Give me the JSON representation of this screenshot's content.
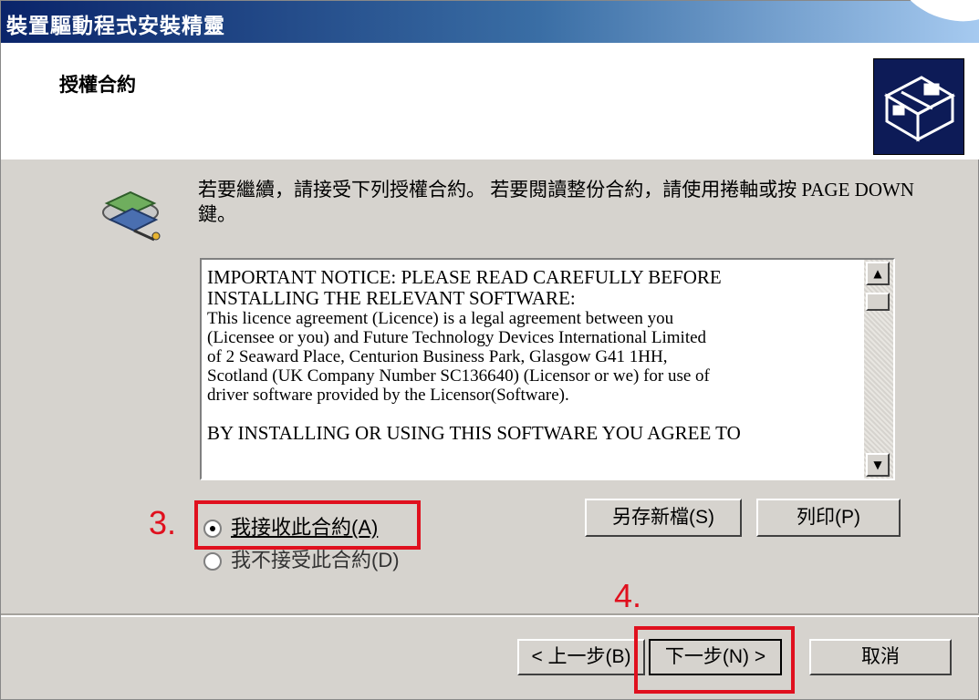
{
  "window": {
    "title": "裝置驅動程式安裝精靈",
    "section_title": "授權合約"
  },
  "instruction": "若要繼續，請接受下列授權合約。 若要閱讀整份合約，請使用捲軸或按 PAGE DOWN 鍵。",
  "license": {
    "line1": "IMPORTANT NOTICE: PLEASE READ CAREFULLY BEFORE",
    "line2": "INSTALLING THE RELEVANT SOFTWARE:",
    "line3": "This licence agreement (Licence) is a legal agreement between you",
    "line4": "(Licensee or you) and Future Technology Devices International Limited",
    "line5": "of 2 Seaward Place, Centurion Business Park, Glasgow G41 1HH,",
    "line6": "Scotland (UK Company Number SC136640) (Licensor or we) for use of",
    "line7": "driver software provided by the Licensor(Software).",
    "line8": "BY INSTALLING OR USING THIS SOFTWARE YOU AGREE TO"
  },
  "options": {
    "accept": "我接收此合約(A)",
    "decline": "我不接受此合約(D)"
  },
  "buttons": {
    "save_as": "另存新檔(S)",
    "print": "列印(P)",
    "back": "< 上一步(B)",
    "next": "下一步(N) >",
    "cancel": "取消"
  },
  "annotations": {
    "step3": "3.",
    "step4": "4."
  },
  "colors": {
    "highlight": "#e0101e",
    "titlebar_start": "#0a246a"
  }
}
